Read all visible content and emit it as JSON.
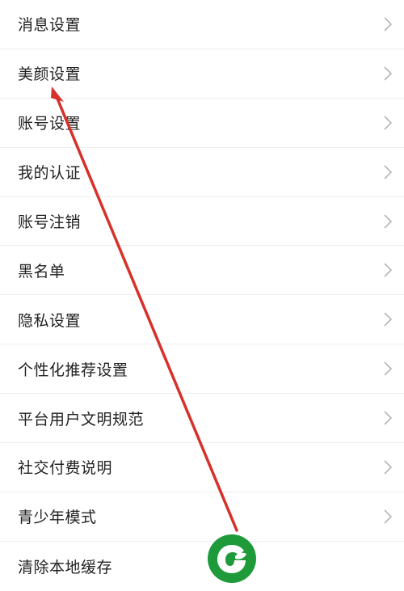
{
  "settings": {
    "items": [
      {
        "label": "消息设置"
      },
      {
        "label": "美颜设置"
      },
      {
        "label": "账号设置"
      },
      {
        "label": "我的认证"
      },
      {
        "label": "账号注销"
      },
      {
        "label": "黑名单"
      },
      {
        "label": "隐私设置"
      },
      {
        "label": "个性化推荐设置"
      },
      {
        "label": "平台用户文明规范"
      },
      {
        "label": "社交付费说明"
      },
      {
        "label": "青少年模式"
      },
      {
        "label": "清除本地缓存"
      }
    ]
  },
  "colors": {
    "annotation_arrow": "#d6312b",
    "logo_green": "#1f9a3a",
    "chevron": "#b5b5b5",
    "divider": "#eeeeee"
  },
  "icons": {
    "row_chevron": "chevron-right-icon",
    "logo": "leaf-logo-icon"
  }
}
